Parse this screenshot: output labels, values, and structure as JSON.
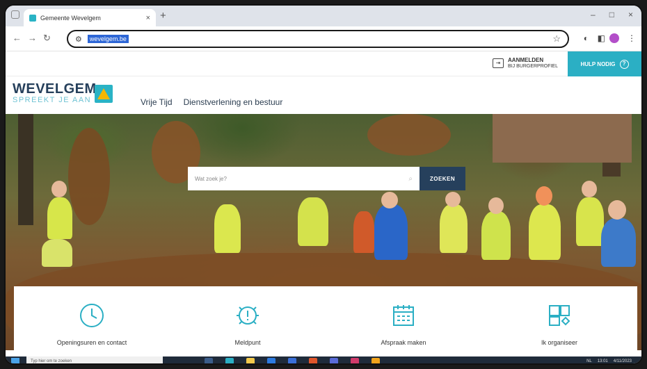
{
  "browser": {
    "tab_title": "Gemeente Wevelgem",
    "tab_close": "×",
    "new_tab": "+",
    "url": "wevelgem.be",
    "win_controls": [
      "–",
      "□",
      "×"
    ]
  },
  "site": {
    "login_label": "AANMELDEN",
    "login_sub": "BIJ BURGERPROFIEL",
    "help_label": "HULP NODIG",
    "help_icon": "?",
    "logo_main": "WEVELGEM",
    "logo_sub": "SPREEKT JE AAN",
    "menu": [
      "Vrije Tijd",
      "Dienstverlening en bestuur"
    ],
    "search_placeholder": "Wat zoek je?",
    "search_button": "ZOEKEN",
    "quick_links": [
      {
        "label": "Openingsuren en contact",
        "icon": "clock-icon"
      },
      {
        "label": "Meldpunt",
        "icon": "alert-icon"
      },
      {
        "label": "Afspraak maken",
        "icon": "calendar-icon"
      },
      {
        "label": "Ik organiseer",
        "icon": "organize-icon"
      }
    ]
  },
  "taskbar": {
    "search_placeholder": "Typ hier om te zoeken",
    "time": "13:01",
    "date": "4/11/2023",
    "lang": "NL"
  }
}
